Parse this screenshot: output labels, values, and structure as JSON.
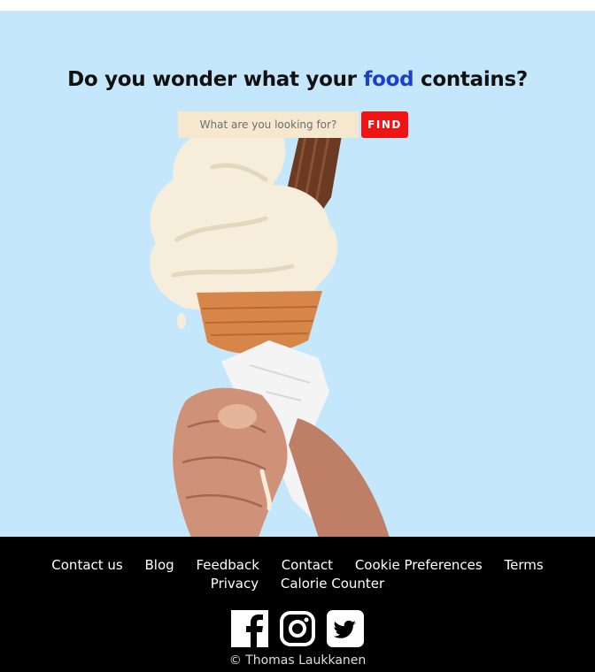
{
  "hero": {
    "headline_before": "Do you wonder what your ",
    "headline_accent": "food",
    "headline_after": " contains?",
    "background_color": "#c5e7fb",
    "accent_color": "#1c3fc7",
    "image_subject": "ice-cream-cone-in-hand"
  },
  "search": {
    "placeholder": "What are you looking for?",
    "value": "",
    "button_label": "FIND",
    "button_color": "#f01414"
  },
  "footer": {
    "links": [
      {
        "label": "Contact us"
      },
      {
        "label": "Blog"
      },
      {
        "label": "Feedback"
      },
      {
        "label": "Contact"
      },
      {
        "label": "Cookie Preferences"
      },
      {
        "label": "Terms"
      },
      {
        "label": "Privacy"
      },
      {
        "label": "Calorie Counter"
      }
    ],
    "social": [
      {
        "icon": "facebook-icon"
      },
      {
        "icon": "instagram-icon"
      },
      {
        "icon": "twitter-icon"
      }
    ],
    "copyright": "© Thomas Laukkanen"
  }
}
